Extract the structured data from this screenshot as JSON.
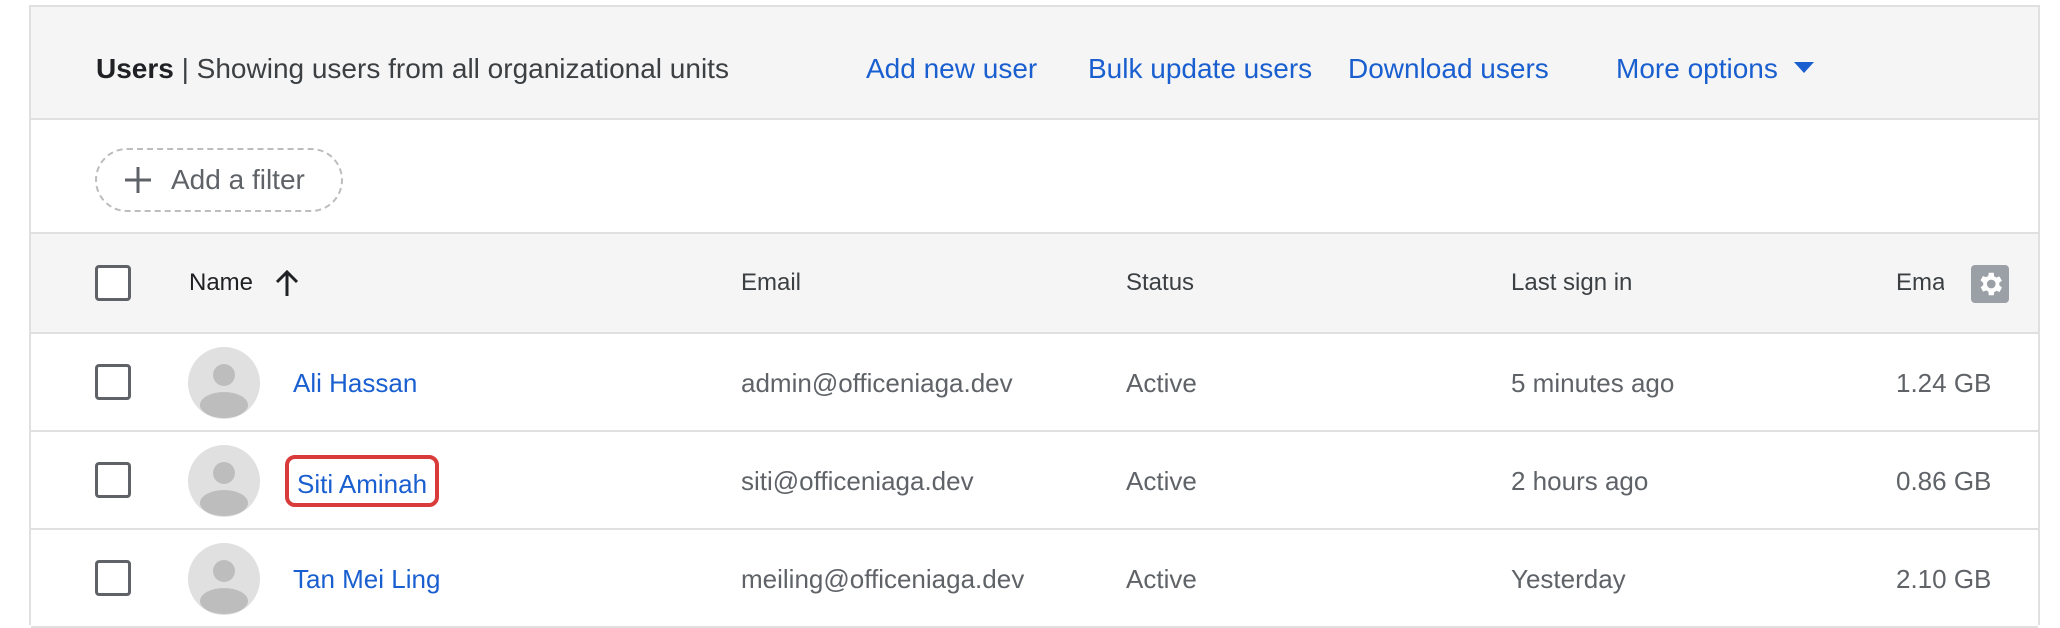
{
  "header": {
    "title": "Users",
    "subtitle": "| Showing users from all organizational units",
    "actions": {
      "add_new_user": "Add new user",
      "bulk_update_users": "Bulk update users",
      "download_users": "Download users",
      "more_options": "More options"
    }
  },
  "filter": {
    "add_label": "Add a filter"
  },
  "columns": {
    "name": "Name",
    "email": "Email",
    "status": "Status",
    "last_sign_in": "Last sign in",
    "email_usage": "Ema"
  },
  "rows": [
    {
      "name": "Ali Hassan",
      "email": "admin@officeniaga.dev",
      "status": "Active",
      "last_sign_in": "5 minutes ago",
      "storage": "1.24 GB"
    },
    {
      "name": "Siti Aminah",
      "email": "siti@officeniaga.dev",
      "status": "Active",
      "last_sign_in": "2 hours ago",
      "storage": "0.86 GB"
    },
    {
      "name": "Tan Mei Ling",
      "email": "meiling@officeniaga.dev",
      "status": "Active",
      "last_sign_in": "Yesterday",
      "storage": "2.10 GB"
    }
  ],
  "colors": {
    "link": "#1a5fd0",
    "highlight": "#d93a3a",
    "header_bg": "#f5f5f5"
  },
  "icons": {
    "sort": "arrow-up-icon",
    "settings": "gear-icon",
    "add": "plus-icon",
    "avatar": "person-icon"
  }
}
